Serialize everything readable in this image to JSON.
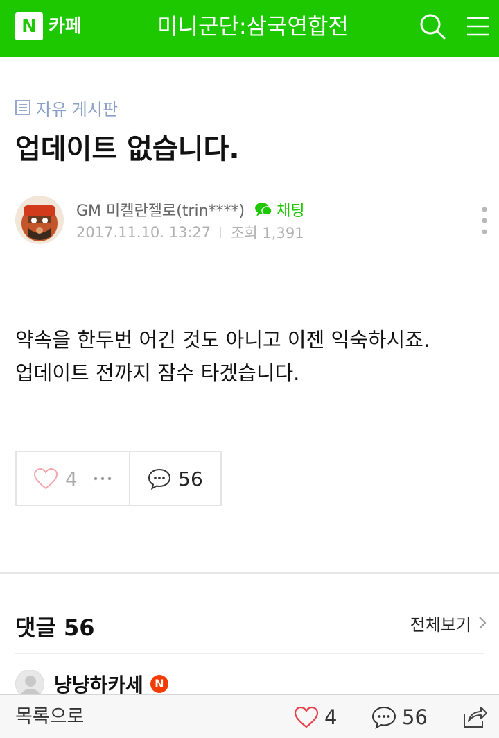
{
  "header": {
    "logo_letter": "N",
    "logo_text": "카페",
    "cafe_name": "미니군단:삼국연합전",
    "accent_color": "#1ec800"
  },
  "post": {
    "board_name": "자유 게시판",
    "title": "업데이트 없습니다.",
    "author": "GM 미켈란젤로(trin****)",
    "chat_label": "채팅",
    "date": "2017.11.10. 13:27",
    "views": "조회 1,391",
    "body_lines": [
      "약속을 한두번 어긴 것도 아니고 이젠 익숙하시죠.",
      "업데이트 전까지 잠수 타겠습니다."
    ]
  },
  "reactions": {
    "like_count": "4",
    "comment_count": "56"
  },
  "comments": {
    "heading": "댓글 56",
    "view_all": "전체보기",
    "first_commenter": "냥냥하카세",
    "badge": "N"
  },
  "bottom_bar": {
    "list_label": "목록으로",
    "like_count": "4",
    "comment_count": "56"
  },
  "icons": [
    "search-icon",
    "menu-icon",
    "board-icon",
    "chat-icon",
    "more-icon",
    "heart-icon",
    "ellipsis-icon",
    "comment-icon",
    "chevron-right-icon",
    "share-icon"
  ]
}
